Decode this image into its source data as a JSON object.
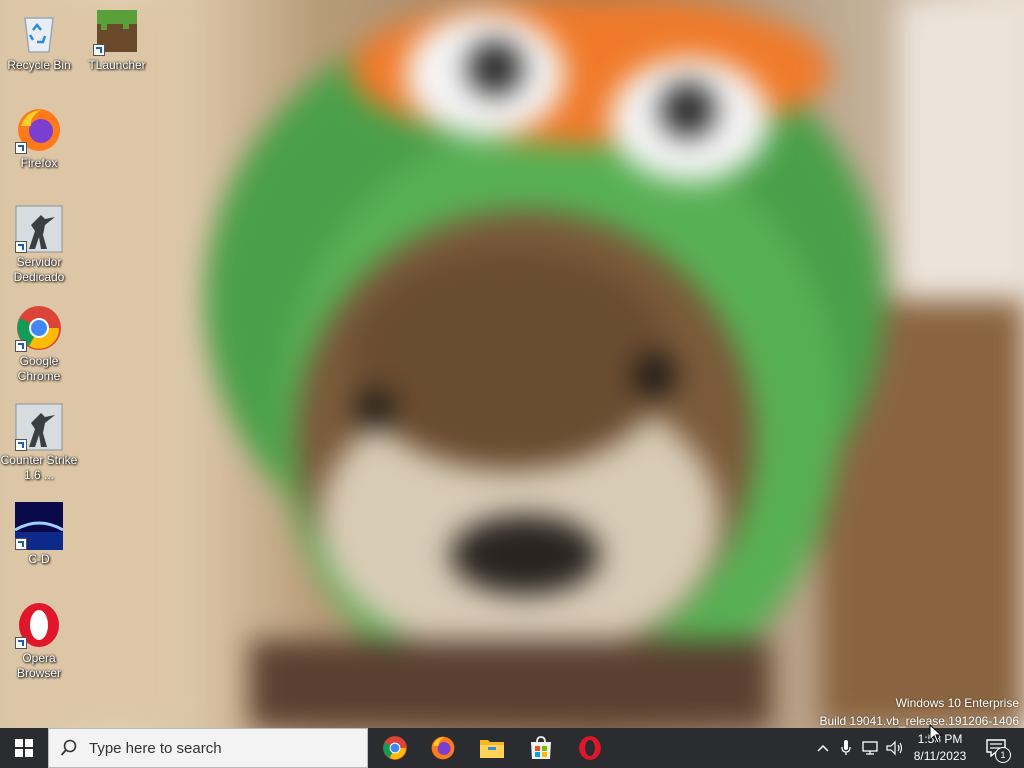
{
  "desktop": {
    "icons": [
      {
        "label": "Recycle Bin",
        "icon": "recycle-bin-icon"
      },
      {
        "label": "TLauncher",
        "icon": "minecraft-block-icon"
      },
      {
        "label": "Firefox",
        "icon": "firefox-icon"
      },
      {
        "label": "Servidor Dedicado",
        "icon": "counter-strike-icon"
      },
      {
        "label": "Google Chrome",
        "icon": "chrome-icon"
      },
      {
        "label": "Counter Strike 1.6 ...",
        "icon": "counter-strike-icon"
      },
      {
        "label": "C-D",
        "icon": "cd-app-icon"
      },
      {
        "label": "Opera Browser",
        "icon": "opera-icon"
      }
    ],
    "watermark": {
      "line1": "Windows 10 Enterprise",
      "line2": "Build 19041.vb_release.191206-1406"
    }
  },
  "taskbar": {
    "search_placeholder": "Type here to search",
    "pinned": [
      "chrome-icon",
      "firefox-icon",
      "file-explorer-icon",
      "microsoft-store-icon",
      "opera-icon"
    ],
    "tray": [
      "chevron-up-icon",
      "microphone-icon",
      "network-icon",
      "volume-icon"
    ],
    "clock": {
      "time": "1:58 PM",
      "date": "8/11/2023"
    },
    "notifications": {
      "count": "1"
    }
  },
  "colors": {
    "taskbar": "#2b2c30",
    "accent": "#1a5fb4"
  }
}
